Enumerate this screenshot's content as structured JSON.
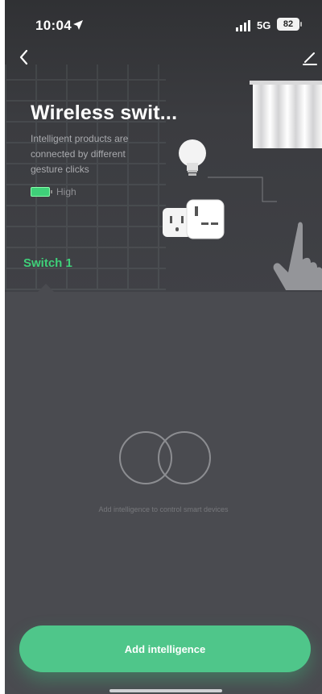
{
  "status_bar": {
    "time": "10:04",
    "network": "5G",
    "battery": "82",
    "icons": [
      "location-arrow-icon",
      "signal-bars-icon"
    ]
  },
  "nav": {
    "back_icon": "chevron-left-icon",
    "edit_icon": "pencil-icon"
  },
  "device": {
    "title": "Wireless swit...",
    "description": "Intelligent products are connected by different gesture clicks",
    "battery_level": "High"
  },
  "tabs": [
    {
      "label": "Switch 1",
      "active": true
    }
  ],
  "empty_state": {
    "icon": "intersecting-rings-icon",
    "message": "Add intelligence to control smart devices"
  },
  "action": {
    "add_label": "Add intelligence"
  },
  "colors": {
    "accent": "#3fd079",
    "button": "#4fc68a",
    "background": "#4a4b50"
  }
}
